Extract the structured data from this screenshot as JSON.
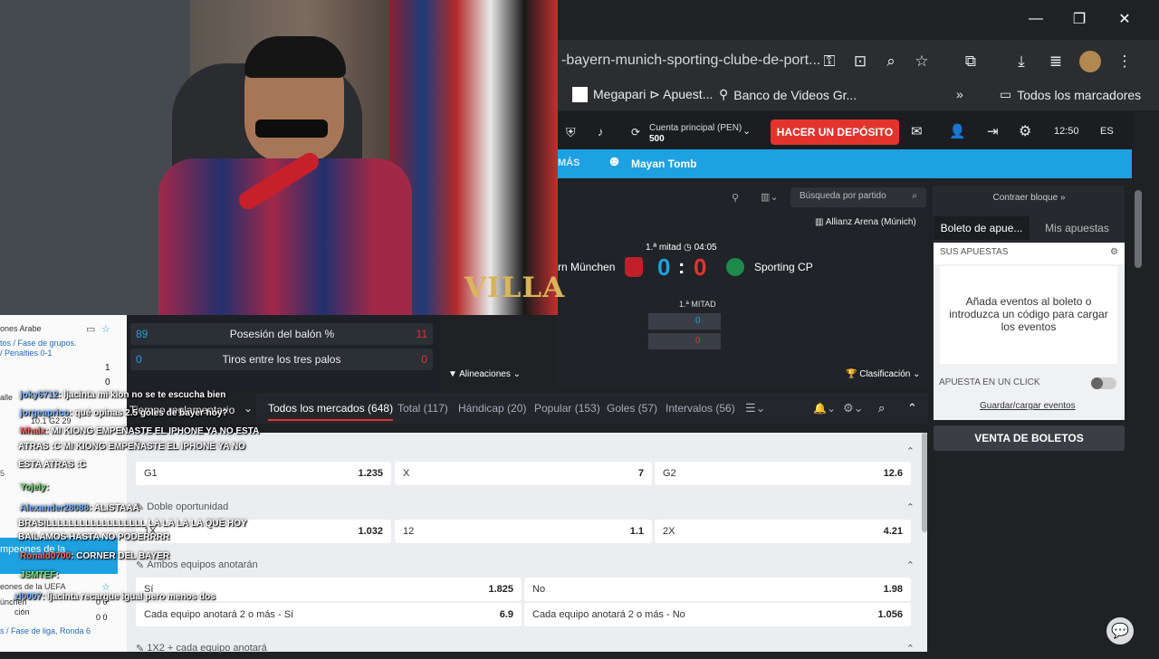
{
  "window": {
    "minimize": "—",
    "maximize": "❐",
    "close": "✕"
  },
  "browser": {
    "url": "-bayern-munich-sporting-clube-de-port...",
    "bookmarks": [
      {
        "label": "Megapari ⊳ Apuest..."
      },
      {
        "label": "Banco de Videos Gr..."
      }
    ],
    "all_bookmarks": "Todos los marcadores",
    "overflow": "»"
  },
  "site": {
    "account_label": "Cuenta principal (PEN)",
    "balance": "500",
    "deposit_button": "HACER UN DEPÓSITO",
    "time": "12:50",
    "lang": "ES",
    "more_label": "MÁS",
    "promo_label": "Mayan Tomb"
  },
  "match": {
    "search_placeholder": "Búsqueda por partido",
    "venue": "Allianz Arena (Múnich)",
    "period": "1.ª mitad",
    "clock": "04:05",
    "home": "rn München",
    "away": "Sporting CP",
    "score_home": "0",
    "score_sep": ":",
    "score_away": "0",
    "mini_period": "1.ª MITAD",
    "mini_home": "0",
    "mini_away": "0",
    "lineups": "Alineaciones",
    "standings": "Clasificación"
  },
  "stats": [
    {
      "left": "89",
      "label": "Posesión del balón %",
      "right": "11"
    },
    {
      "left": "0",
      "label": "Tiros entre los tres palos",
      "right": "0"
    }
  ],
  "sidebar": {
    "collapse": "Contraer bloque »",
    "tab_slip": "Boleto de apue...",
    "tab_bets": "Mis apuestas",
    "your_bets": "SUS APUESTAS",
    "empty_msg": "Añada eventos al boleto o introduzca un código para cargar los eventos",
    "one_click": "APUESTA EN UN CLICK",
    "save_load": "Guardar/cargar eventos",
    "sale": "VENTA DE BOLETOS"
  },
  "tabs": {
    "reg": "Tiempo reglamentario",
    "items": [
      "Todos los mercados (648)",
      "Total (117)",
      "Hándicap (20)",
      "Popular (153)",
      "Goles (57)",
      "Intervalos (56)"
    ]
  },
  "markets": [
    {
      "title": "",
      "odds": [
        {
          "l": "G1",
          "v": "1.235"
        },
        {
          "l": "X",
          "v": "7"
        },
        {
          "l": "G2",
          "v": "12.6"
        }
      ]
    },
    {
      "title": "Doble oportunidad",
      "odds": [
        {
          "l": "1X",
          "v": "1.032"
        },
        {
          "l": "12",
          "v": "1.1"
        },
        {
          "l": "2X",
          "v": "4.21"
        }
      ]
    },
    {
      "title": "Ambos equipos anotarán",
      "odds": [
        {
          "l": "Sí",
          "v": "1.825"
        },
        {
          "l": "No",
          "v": "1.98"
        }
      ],
      "odds2": [
        {
          "l": "Cada equipo anotará 2 o más - Sí",
          "v": "6.9"
        },
        {
          "l": "Cada equipo anotará 2 o más - No",
          "v": "1.056"
        }
      ]
    },
    {
      "title": "1X2 + cada equipo anotará"
    }
  ],
  "chat": [
    {
      "user": "joky6712",
      "text": ": ljacinta mi kion no se te escucha bien"
    },
    {
      "user": "jorgeaprico",
      "text": ": qué opinas 2.5 goles de bayer hoy?"
    },
    {
      "user": "Mhalx",
      "text": ": MI KIONG EMPEÑASTE EL IPHONE YA NO ESTA"
    },
    {
      "user": "",
      "text": "ATRAS :C    MI KIONG EMPEÑASTE EL IPHONE YA NO"
    },
    {
      "user": "",
      "text": "ESTA ATRAS :C"
    },
    {
      "user": "Yojely",
      "text": ":"
    },
    {
      "user": "Alexander28088",
      "text": ": ALISTAAA"
    },
    {
      "user": "",
      "text": "BRASILLLLLLLLLLLLLLLLLL LA LA LA LA QUE HOY"
    },
    {
      "user": "",
      "text": "BAILAMOS HASTA NO PODERRRR"
    },
    {
      "user": "Ronald0700",
      "text": ": CORNER DEL BAYER"
    },
    {
      "user": "JSMTEF",
      "text": ":"
    },
    {
      "user": "zl0007",
      "text": ": ljacinta recargue igual pero menos dos"
    }
  ],
  "leftpanel": {
    "l1": "ones Arabe",
    "l2": "tos / Fase de grupos.",
    "l3": "/ Penalties 0-1",
    "n1": "1",
    "n2": "0",
    "l4": "alle",
    "l5": "10.1  G2  29",
    "l6": "5",
    "l7": "mpeones de la",
    "l8": "eones de la UEFA",
    "l9": "ünchen",
    "l10": "ción",
    "l11": "s / Fase de liga, Ronda 6",
    "n3": "0 0",
    "n4": "0 0"
  },
  "overlay": {
    "brand": "VILLA"
  },
  "colors": {
    "accent": "#1da1e0",
    "deposit": "#e2342d",
    "score": "#1da1e0"
  }
}
